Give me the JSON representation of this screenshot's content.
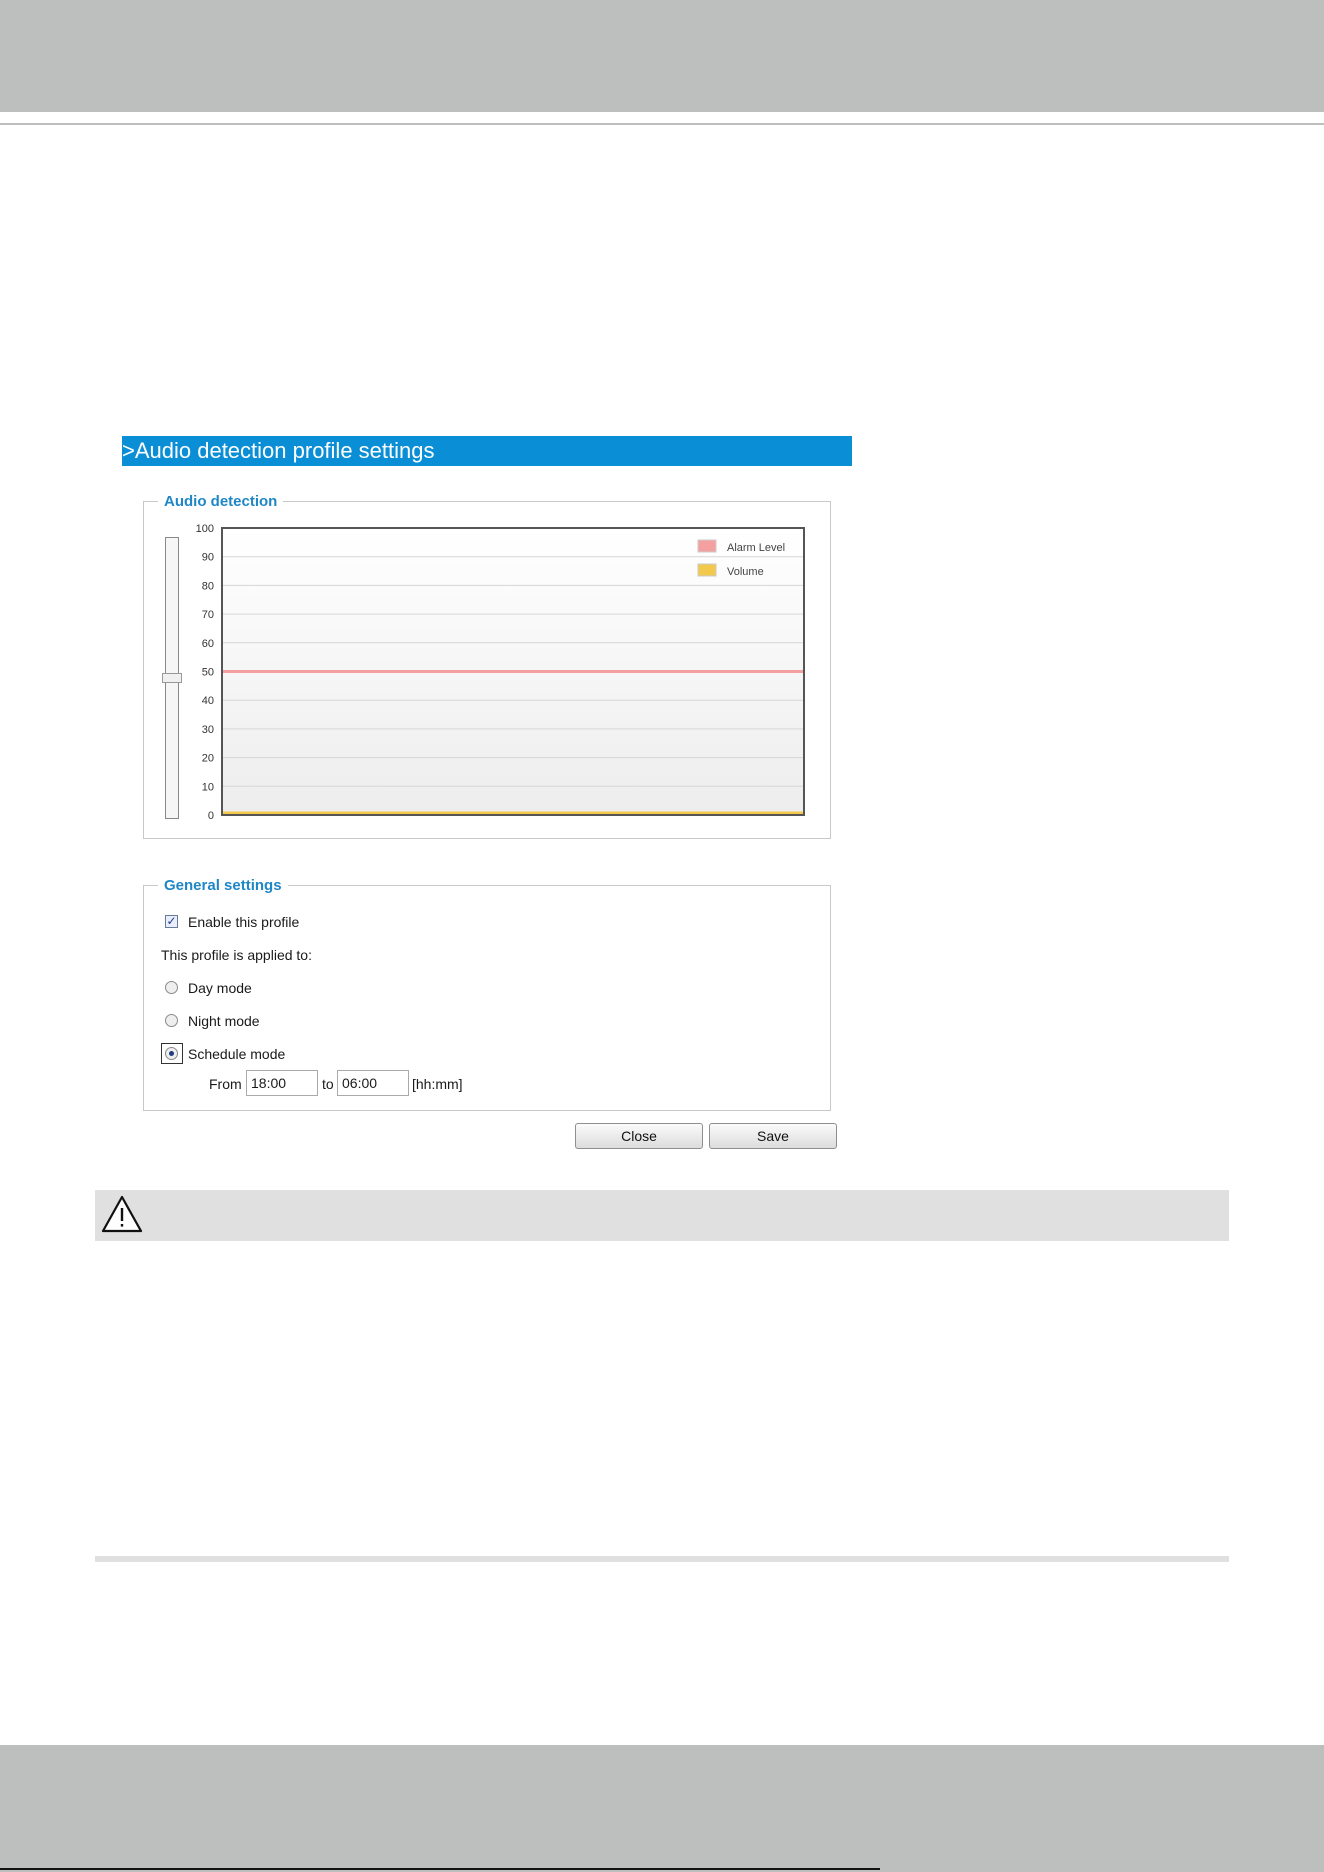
{
  "panel": {
    "title": ">Audio detection profile settings"
  },
  "audio_detection": {
    "legend": "Audio detection",
    "alarm_level": 50,
    "chart_legend": [
      "Alarm Level",
      "Volume"
    ]
  },
  "chart_data": {
    "type": "line",
    "ylim": [
      0,
      100
    ],
    "yticks": [
      "100",
      "90",
      "80",
      "70",
      "60",
      "50",
      "40",
      "30",
      "20",
      "10",
      "0"
    ],
    "series": [
      {
        "name": "Alarm Level",
        "color": "#f4a0a0",
        "values": [
          50,
          50
        ]
      },
      {
        "name": "Volume",
        "color": "#f2c94c",
        "values": [
          0,
          0
        ]
      }
    ],
    "grid": true,
    "legend_position": "top-right"
  },
  "general": {
    "legend": "General settings",
    "enable_label": "Enable this profile",
    "enable_checked": true,
    "applied_to_label": "This profile is applied to:",
    "day_mode_label": "Day mode",
    "night_mode_label": "Night mode",
    "schedule_mode_label": "Schedule mode",
    "selected_mode": "schedule",
    "from_label": "From",
    "from_value": "18:00",
    "to_label": "to",
    "to_value": "06:00",
    "format_label": "[hh:mm]"
  },
  "buttons": {
    "close": "Close",
    "save": "Save"
  },
  "icons": {
    "warning": "warning-triangle-icon",
    "checkbox_mark": "✓"
  },
  "colors": {
    "title_bar": "#0a8ed6",
    "legend_text": "#1f87c6",
    "alarm_level": "#f4a0a0",
    "volume": "#f2c94c"
  }
}
